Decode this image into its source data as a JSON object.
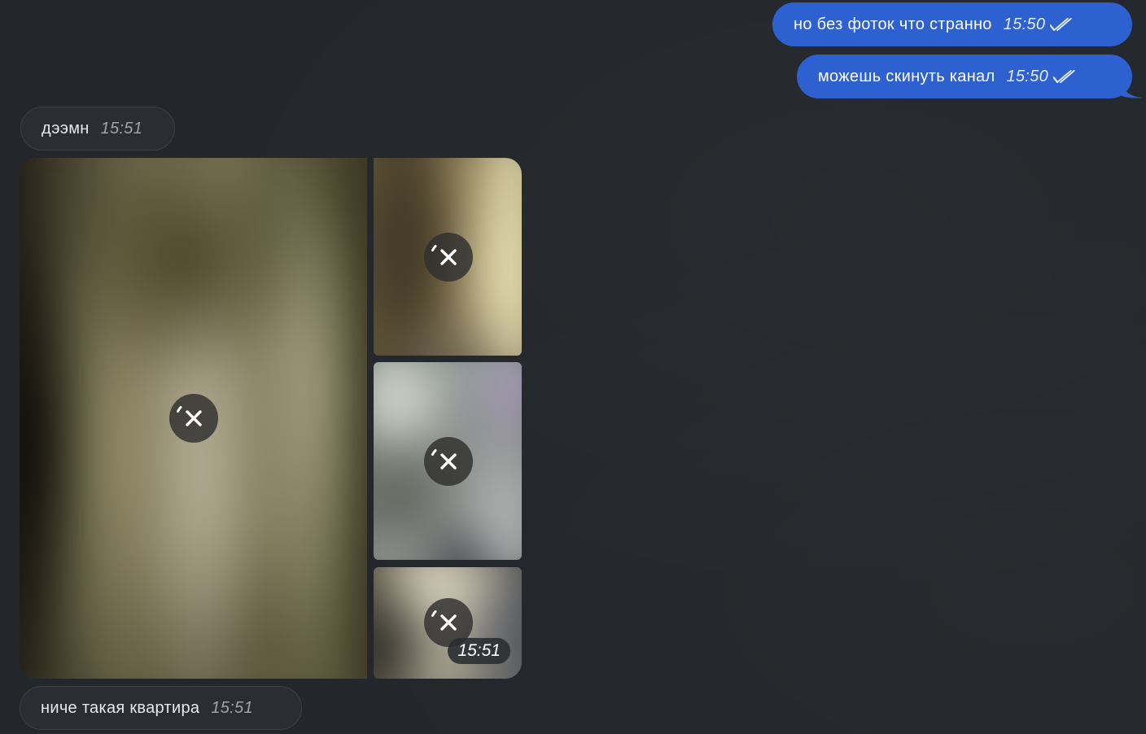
{
  "messages": {
    "outgoing_1": {
      "text": "но без фоток что странно",
      "time": "15:50",
      "status": "double-check-icon"
    },
    "outgoing_2": {
      "text": "можешь скинуть канал",
      "time": "15:50",
      "status": "double-check-icon"
    },
    "incoming_1": {
      "text": "дээмн",
      "time": "15:51"
    },
    "album": {
      "time": "15:51",
      "photos": [
        {
          "state": "download",
          "icon": "download-cancel-icon"
        },
        {
          "state": "download",
          "icon": "download-cancel-icon"
        },
        {
          "state": "download",
          "icon": "download-cancel-icon"
        },
        {
          "state": "download",
          "icon": "download-cancel-icon"
        }
      ]
    },
    "incoming_2": {
      "text": "ниче такая квартира",
      "time": "15:51"
    }
  },
  "colors": {
    "background": "#23272b",
    "outgoing_bubble": "#2c61cf",
    "incoming_bubble": "#2a2d31"
  }
}
